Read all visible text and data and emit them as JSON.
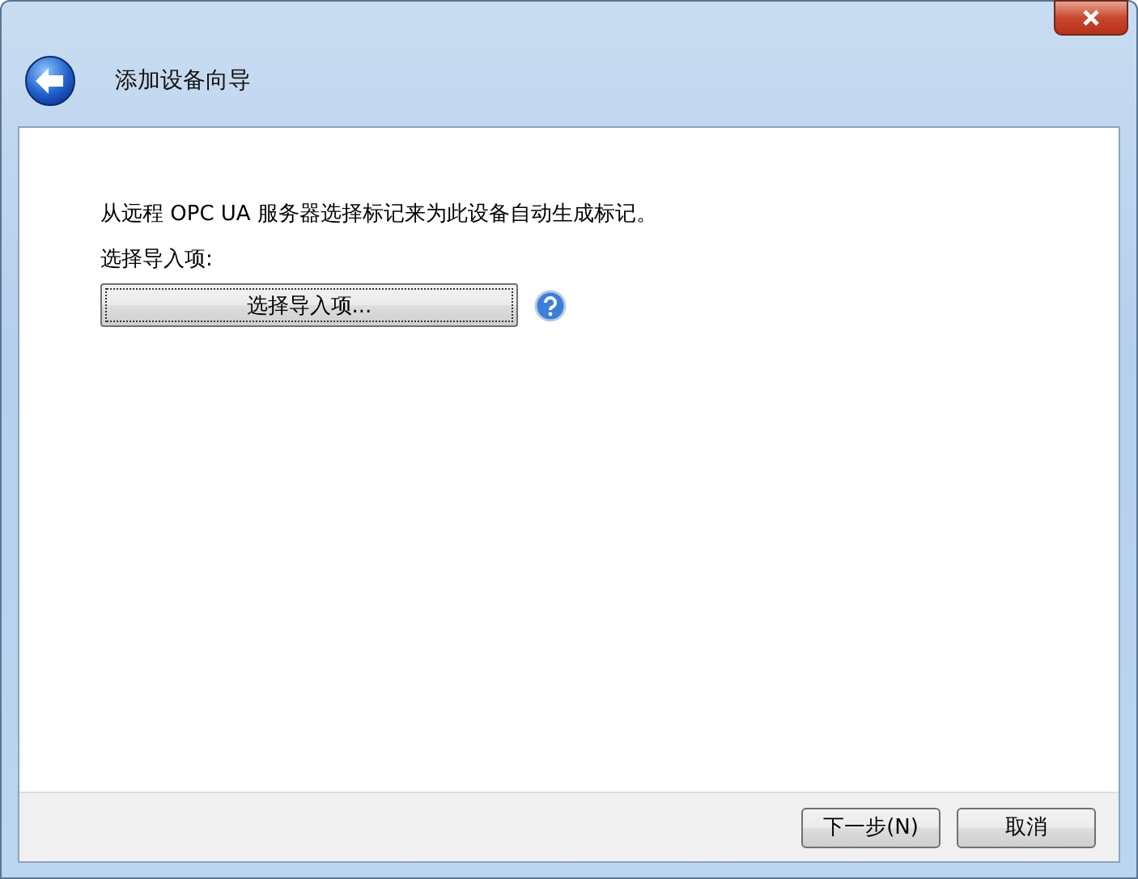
{
  "window": {
    "title": "添加设备向导"
  },
  "description": "从远程 OPC UA 服务器选择标记来为此设备自动生成标记。",
  "import_label": "选择导入项:",
  "import_button": "选择导入项...",
  "buttons": [
    "下一步(N)",
    "取消"
  ]
}
